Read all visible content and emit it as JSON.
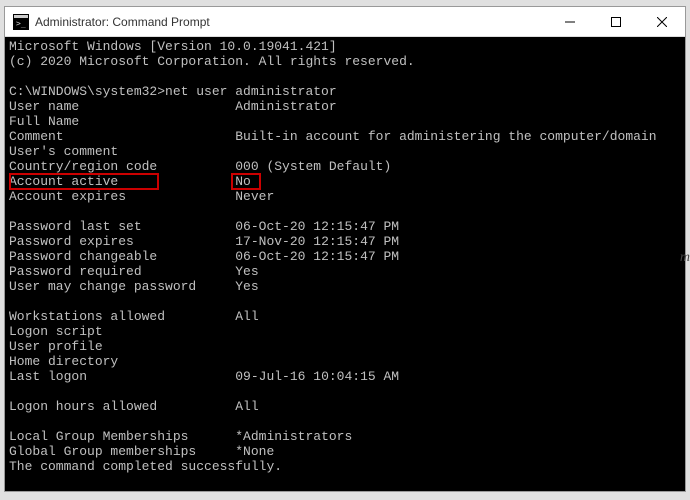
{
  "window": {
    "title": "Administrator: Command Prompt"
  },
  "os": {
    "line1": "Microsoft Windows [Version 10.0.19041.421]",
    "line2": "(c) 2020 Microsoft Corporation. All rights reserved."
  },
  "prompt": {
    "path": "C:\\WINDOWS\\system32>",
    "command": "net user administrator"
  },
  "fields": {
    "user_name": {
      "label": "User name",
      "value": "Administrator"
    },
    "full_name": {
      "label": "Full Name",
      "value": ""
    },
    "comment": {
      "label": "Comment",
      "value": "Built-in account for administering the computer/domain"
    },
    "users_comment": {
      "label": "User's comment",
      "value": ""
    },
    "country_code": {
      "label": "Country/region code",
      "value": "000 (System Default)"
    },
    "account_active": {
      "label": "Account active",
      "value": "No"
    },
    "account_expires": {
      "label": "Account expires",
      "value": "Never"
    },
    "pwd_last_set": {
      "label": "Password last set",
      "value": "‎06-‎Oct-‎20 12:15:47 PM"
    },
    "pwd_expires": {
      "label": "Password expires",
      "value": "‎17-‎Nov-‎20 12:15:47 PM"
    },
    "pwd_changeable": {
      "label": "Password changeable",
      "value": "‎06-‎Oct-‎20 12:15:47 PM"
    },
    "pwd_required": {
      "label": "Password required",
      "value": "Yes"
    },
    "pwd_user_change": {
      "label": "User may change password",
      "value": "Yes"
    },
    "workstations": {
      "label": "Workstations allowed",
      "value": "All"
    },
    "logon_script": {
      "label": "Logon script",
      "value": ""
    },
    "user_profile": {
      "label": "User profile",
      "value": ""
    },
    "home_dir": {
      "label": "Home directory",
      "value": ""
    },
    "last_logon": {
      "label": "Last logon",
      "value": "‎09-‎Jul-‎16 10:04:15 AM"
    },
    "logon_hours": {
      "label": "Logon hours allowed",
      "value": "All"
    },
    "local_groups": {
      "label": "Local Group Memberships",
      "value": "*Administrators"
    },
    "global_groups": {
      "label": "Global Group memberships",
      "value": "*None"
    }
  },
  "footer": "The command completed successfully.",
  "highlight": {
    "field": "account_active"
  }
}
